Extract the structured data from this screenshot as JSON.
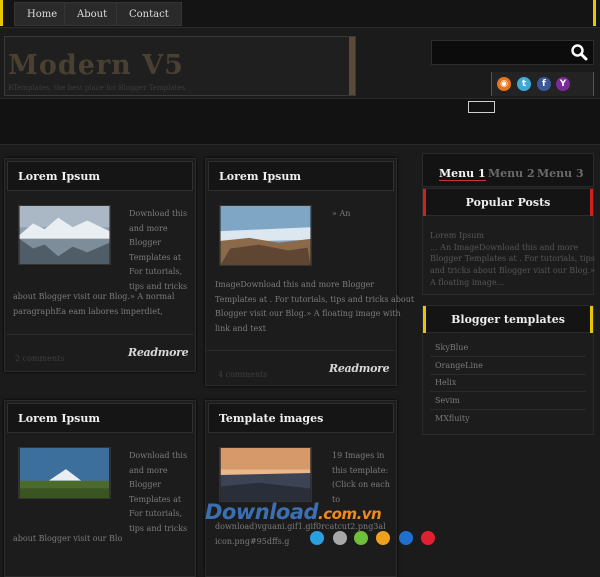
{
  "nav": {
    "items": [
      "Home",
      "About",
      "Contact"
    ]
  },
  "header": {
    "title": "Modern V5",
    "subtitle": "BTemplates, the best place for Blogger Templates"
  },
  "social": {
    "icons": [
      "rss-icon",
      "twitter-icon",
      "facebook-icon",
      "yahoo-icon"
    ]
  },
  "posts": [
    {
      "title": "Lorem Ipsum",
      "text_side": [
        "Download this",
        "and more",
        "Blogger",
        "Templates at",
        "For tutorials,",
        "tips and tricks"
      ],
      "text_full": [
        "about Blogger visit our Blog.» A normal",
        "paragraphEa eam labores imperdiet,"
      ],
      "comments": "2 comments",
      "readmore": "Readmore"
    },
    {
      "title": "Lorem Ipsum",
      "text_side": [
        "» An"
      ],
      "text_full": [
        "ImageDownload this and more Blogger",
        "Templates at . For tutorials, tips and tricks about",
        "Blogger visit our Blog.» A floating image with",
        "link and text"
      ],
      "comments": "4 comments",
      "readmore": "Readmore"
    },
    {
      "title": "Lorem Ipsum",
      "text_side": [
        "Download this",
        "and more",
        "Blogger",
        "Templates at",
        "For tutorials,",
        "tips and tricks"
      ],
      "text_full": [
        "about Blogger visit our Blo"
      ]
    },
    {
      "title": "Template images",
      "text_side": [
        "19 Images in",
        "this template:",
        "(Click on each",
        "to"
      ],
      "text_full": [
        "download)vguani.gif1.gif0rcatcut2.png3al",
        "icon.png#95dffs.g"
      ]
    }
  ],
  "sidebar": {
    "tabs": [
      "Menu 1",
      "Menu 2",
      "Menu 3"
    ],
    "popular": {
      "title": "Popular Posts",
      "text": [
        "Lorem Ipsum",
        "... An ImageDownload this and more",
        "Blogger Templates at . For tutorials, tips",
        "and tricks about Blogger visit our Blog.»",
        "A floating image..."
      ]
    },
    "templates": {
      "title": "Blogger templates",
      "items": [
        "SkyBlue",
        "OrangeLine",
        "Helix",
        "Sevim",
        "MXfluity"
      ]
    }
  },
  "watermark": {
    "text": "Download",
    "domain": ".com.vn"
  },
  "colors": {
    "accent_yellow": "#e7c800",
    "accent_red": "#d02020"
  }
}
